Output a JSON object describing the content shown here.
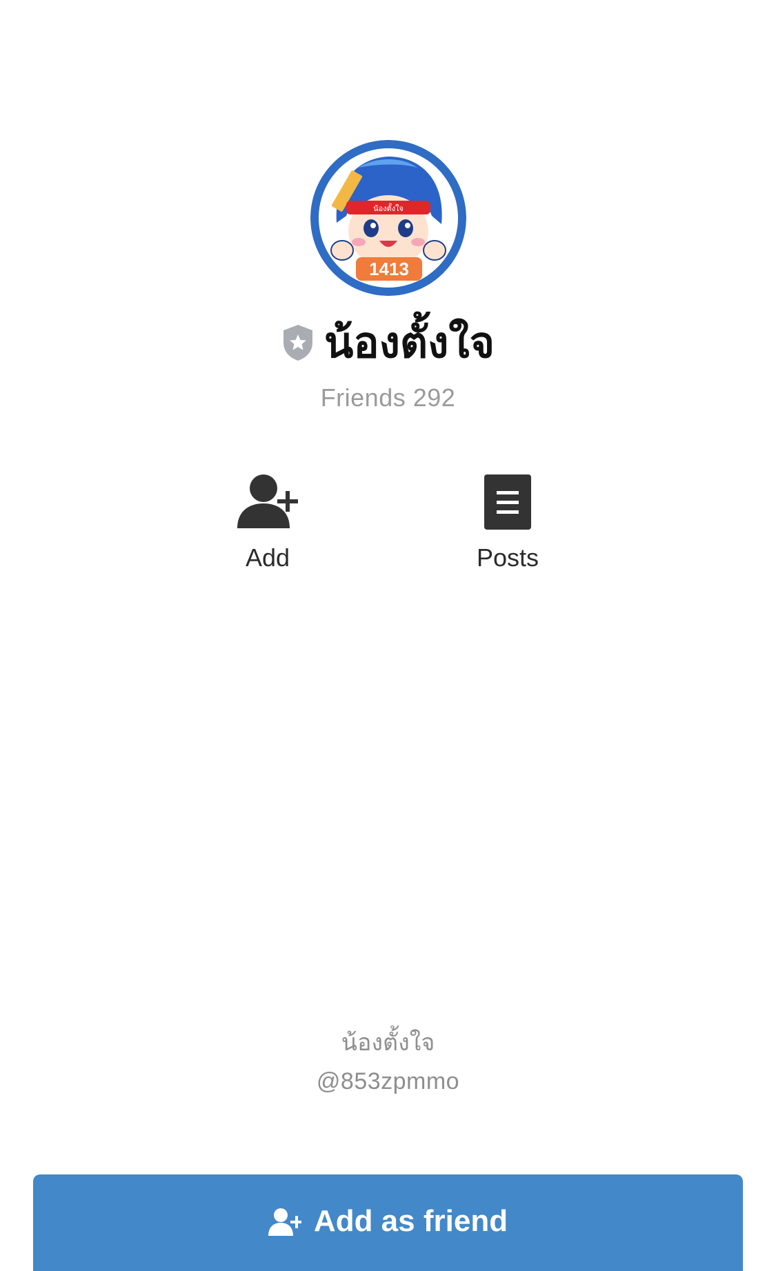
{
  "profile": {
    "name": "น้องตั้งใจ",
    "friends_text": "Friends 292",
    "avatar_badge_text": "1413",
    "headband_text": "น้องตั้งใจ"
  },
  "actions": {
    "add_label": "Add",
    "posts_label": "Posts"
  },
  "footer": {
    "name": "น้องตั้งใจ",
    "id": "@853zpmmo"
  },
  "button": {
    "label": "Add as friend"
  },
  "icons": {
    "verified": "verified-badge-icon",
    "add": "add-user-icon",
    "posts": "posts-document-icon",
    "button": "add-user-icon"
  },
  "colors": {
    "accent": "#4388c8",
    "icon_dark": "#333333",
    "muted_text": "#9a9a9a",
    "avatar_ring": "#2f6cc4",
    "headband": "#e0262b"
  }
}
